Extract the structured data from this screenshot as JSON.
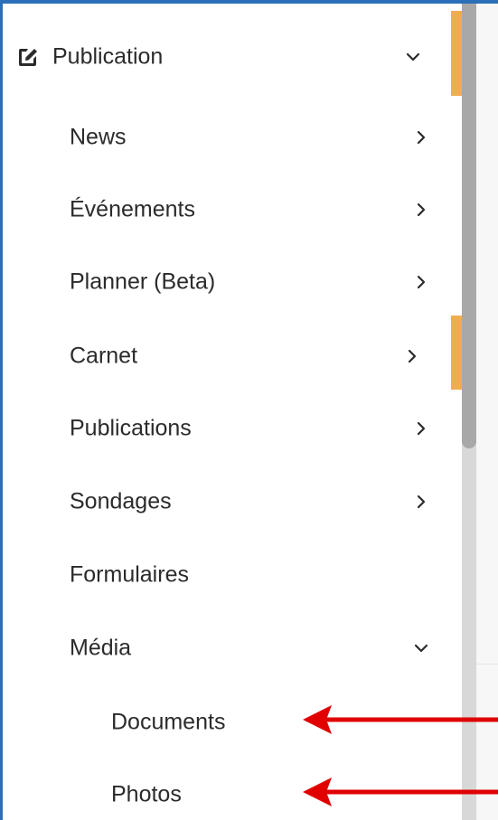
{
  "menu": {
    "section": {
      "label": "Publication",
      "icon": "edit-icon",
      "state": "expanded"
    },
    "items": [
      {
        "label": "News",
        "icon": "chevron-right-icon"
      },
      {
        "label": "Événements",
        "icon": "chevron-right-icon"
      },
      {
        "label": "Planner (Beta)",
        "icon": "chevron-right-icon"
      },
      {
        "label": "Carnet",
        "icon": "chevron-right-icon"
      },
      {
        "label": "Publications",
        "icon": "chevron-right-icon"
      },
      {
        "label": "Sondages",
        "icon": "chevron-right-icon"
      },
      {
        "label": "Formulaires",
        "icon": ""
      },
      {
        "label": "Média",
        "icon": "chevron-down-icon"
      }
    ],
    "subitems": [
      {
        "label": "Documents"
      },
      {
        "label": "Photos"
      }
    ]
  },
  "colors": {
    "frame_border": "#2a6fb7",
    "accent": "#f0ad4e",
    "annotation_arrow": "#e00000",
    "text": "#2b2b2b"
  }
}
